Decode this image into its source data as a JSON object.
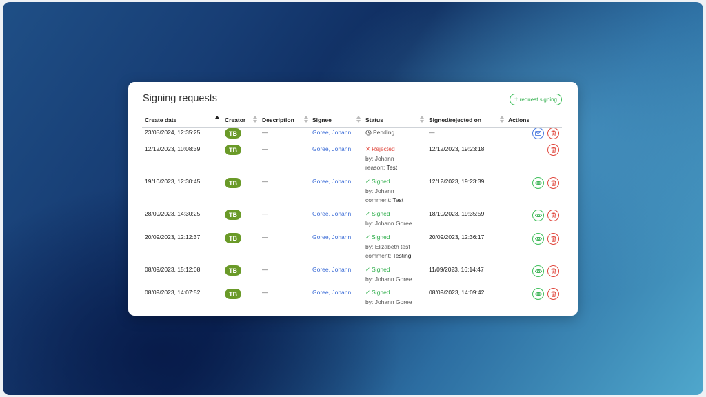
{
  "panel": {
    "title": "Signing requests",
    "request_button": "request signing"
  },
  "columns": [
    {
      "label": "Create date"
    },
    {
      "label": "Creator"
    },
    {
      "label": "Description"
    },
    {
      "label": "Signee"
    },
    {
      "label": "Status"
    },
    {
      "label": "Signed/rejected on"
    },
    {
      "label": "Actions"
    }
  ],
  "rows": [
    {
      "create_date": "23/05/2024, 12:35:25",
      "creator": "TB",
      "description": "—",
      "signee": "Goree, Johann",
      "status": "Pending",
      "by": "",
      "note_label": "",
      "note": "",
      "signed_on": "—"
    },
    {
      "create_date": "12/12/2023, 10:08:39",
      "creator": "TB",
      "description": "—",
      "signee": "Goree, Johann",
      "status": "Rejected",
      "by": "by: Johann",
      "note_label": "reason:",
      "note": "Test",
      "signed_on": "12/12/2023, 19:23:18"
    },
    {
      "create_date": "19/10/2023, 12:30:45",
      "creator": "TB",
      "description": "—",
      "signee": "Goree, Johann",
      "status": "Signed",
      "by": "by: Johann",
      "note_label": "comment:",
      "note": "Test",
      "signed_on": "12/12/2023, 19:23:39"
    },
    {
      "create_date": "28/09/2023, 14:30:25",
      "creator": "TB",
      "description": "—",
      "signee": "Goree, Johann",
      "status": "Signed",
      "by": "by: Johann Goree",
      "note_label": "",
      "note": "",
      "signed_on": "18/10/2023, 19:35:59"
    },
    {
      "create_date": "20/09/2023, 12:12:37",
      "creator": "TB",
      "description": "—",
      "signee": "Goree, Johann",
      "status": "Signed",
      "by": "by: Elizabeth test",
      "note_label": "comment:",
      "note": "Testing",
      "signed_on": "20/09/2023, 12:36:17"
    },
    {
      "create_date": "08/09/2023, 15:12:08",
      "creator": "TB",
      "description": "—",
      "signee": "Goree, Johann",
      "status": "Signed",
      "by": "by: Johann Goree",
      "note_label": "",
      "note": "",
      "signed_on": "11/09/2023, 16:14:47"
    },
    {
      "create_date": "08/09/2023, 14:07:52",
      "creator": "TB",
      "description": "—",
      "signee": "Goree, Johann",
      "status": "Signed",
      "by": "by: Johann Goree",
      "note_label": "",
      "note": "",
      "signed_on": "08/09/2023, 14:09:42"
    }
  ],
  "colors": {
    "accent_green": "#2fae4b",
    "rejected_red": "#e0483e",
    "link_blue": "#3a6bd6",
    "badge_green": "#6a9a28"
  }
}
